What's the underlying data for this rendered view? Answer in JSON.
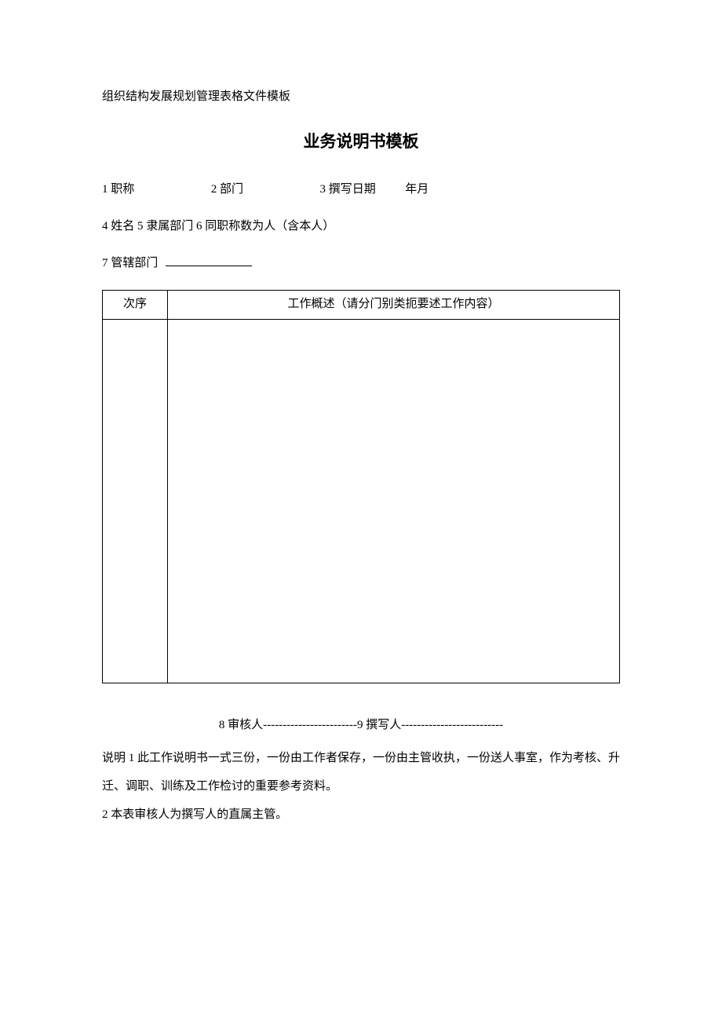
{
  "header": "组织结构发展规划管理表格文件模板",
  "title": "业务说明书模板",
  "fields": {
    "f1": "1 职称",
    "f2": "2 部门",
    "f3": "3 撰写日期",
    "f3_suffix": "年月",
    "f4": "4 姓名 5 隶属部门 6 同职称数为人（含本人）",
    "f7": "7 管辖部门"
  },
  "table": {
    "col1": "次序",
    "col2": "工作概述（请分门别类扼要述工作内容）"
  },
  "sig": {
    "left": "8 审核人",
    "right": "9 撰写人",
    "dashes_mid": "------------------------",
    "dashes_end": "--------------------------"
  },
  "notes": {
    "line1": "说明 1 此工作说明书一式三份，一份由工作者保存，一份由主管收执，一份送人事室，作为考核、升迁、调职、训练及工作检讨的重要参考资料。",
    "line2": "2 本表审核人为撰写人的直属主管。"
  }
}
